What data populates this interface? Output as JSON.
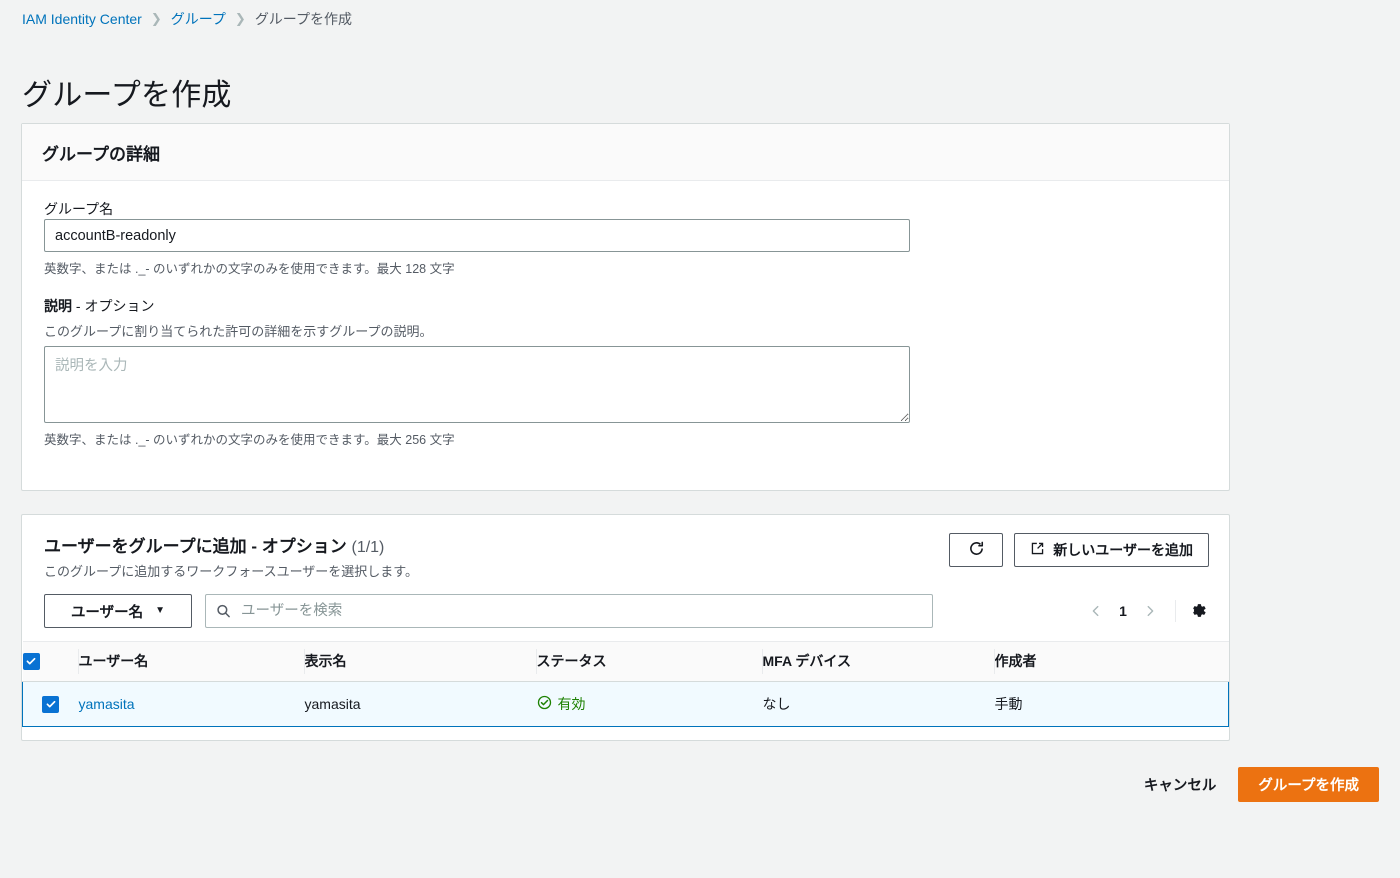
{
  "breadcrumb": {
    "items": [
      {
        "label": "IAM Identity Center",
        "current": false
      },
      {
        "label": "グループ",
        "current": false
      },
      {
        "label": "グループを作成",
        "current": true
      }
    ],
    "separator": "❯"
  },
  "page": {
    "title": "グループを作成"
  },
  "details": {
    "card_title": "グループの詳細",
    "group_name_label": "グループ名",
    "group_name_value": "accountB-readonly",
    "group_name_hint": "英数字、または ._- のいずれかの文字のみを使用できます。最大 128 文字",
    "description_label": "説明",
    "description_optional": " - オプション",
    "description_desc": "このグループに割り当てられた許可の詳細を示すグループの説明。",
    "description_placeholder": "説明を入力",
    "description_value": "",
    "description_hint": "英数字、または ._- のいずれかの文字のみを使用できます。最大 256 文字"
  },
  "users": {
    "title": "ユーザーをグループに追加 - オプション",
    "count": "(1/1)",
    "subtitle": "このグループに追加するワークフォースユーザーを選択します。",
    "refresh_icon": "refresh-icon",
    "add_user_label": "新しいユーザーを追加",
    "add_user_icon": "external-link-icon",
    "filter_select_value": "ユーザー名",
    "search_placeholder": "ユーザーを検索",
    "search_value": "",
    "search_icon": "search-icon",
    "pagination": {
      "prev_icon": "chevron-left-icon",
      "page": "1",
      "next_icon": "chevron-right-icon",
      "settings_icon": "gear-icon"
    },
    "table": {
      "columns": [
        "ユーザー名",
        "表示名",
        "ステータス",
        "MFA デバイス",
        "作成者"
      ],
      "rows": [
        {
          "selected": true,
          "username": "yamasita",
          "display_name": "yamasita",
          "status": "有効",
          "status_icon": "status-success-icon",
          "mfa_device": "なし",
          "created_by": "手動"
        }
      ]
    }
  },
  "footer": {
    "cancel_label": "キャンセル",
    "submit_label": "グループを作成"
  },
  "colors": {
    "page_bg": "#f2f3f3",
    "link": "#0073bb",
    "primary_button": "#ec7211",
    "checkbox": "#0972d3",
    "status_success": "#1d8102",
    "selected_row_bg": "#f1faff"
  }
}
